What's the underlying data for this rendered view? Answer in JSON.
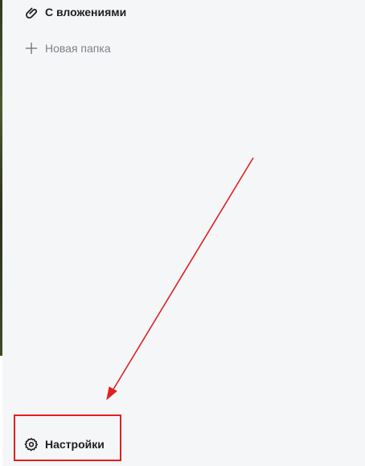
{
  "sidebar": {
    "items": [
      {
        "label": "С вложениями",
        "icon": "paperclip-icon"
      },
      {
        "label": "Новая папка",
        "icon": "plus-icon"
      }
    ],
    "settings": {
      "label": "Настройки",
      "icon": "gear-icon"
    }
  },
  "annotation": {
    "color": "#e02020"
  }
}
